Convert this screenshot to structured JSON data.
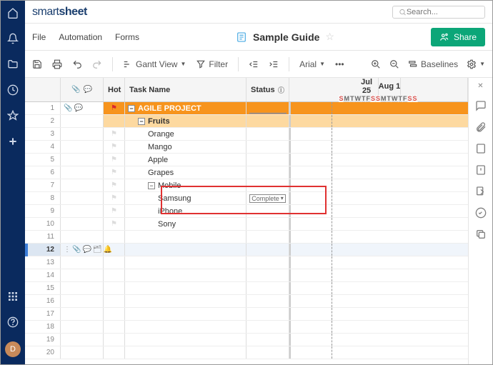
{
  "app": {
    "logo_prefix": "smart",
    "logo_bold": "sheet"
  },
  "search": {
    "placeholder": "Search..."
  },
  "menubar": {
    "items": [
      "File",
      "Automation",
      "Forms"
    ],
    "title": "Sample Guide"
  },
  "share": {
    "label": "Share"
  },
  "toolbar": {
    "view_label": "Gantt View",
    "filter_label": "Filter",
    "font_label": "Arial",
    "baselines_label": "Baselines"
  },
  "columns": {
    "hot": "Hot",
    "task": "Task Name",
    "status": "Status"
  },
  "gantt": {
    "months": [
      "Jul 25",
      "Aug 1"
    ],
    "days": [
      "S",
      "M",
      "T",
      "W",
      "T",
      "F",
      "S",
      "S",
      "M",
      "T",
      "W",
      "T",
      "F",
      "S",
      "S"
    ],
    "weekend_indices": [
      0,
      6,
      7,
      13,
      14
    ],
    "today_pct": 23
  },
  "rows": [
    {
      "n": 1,
      "level": 0,
      "task": "AGILE PROJECT",
      "flag": "red",
      "toggle": "−",
      "attach": true,
      "comment": true
    },
    {
      "n": 2,
      "level": 1,
      "task": "Fruits",
      "toggle": "−"
    },
    {
      "n": 3,
      "level": 2,
      "task": "Orange",
      "flag": "gray"
    },
    {
      "n": 4,
      "level": 2,
      "task": "Mango",
      "flag": "gray"
    },
    {
      "n": 5,
      "level": 2,
      "task": "Apple",
      "flag": "gray"
    },
    {
      "n": 6,
      "level": 2,
      "task": "Grapes",
      "flag": "gray"
    },
    {
      "n": 7,
      "level": 2,
      "task": "Mobile",
      "flag": "gray",
      "toggle": "−"
    },
    {
      "n": 8,
      "level": 3,
      "task": "Samsung",
      "flag": "gray",
      "status": "Complete",
      "status_dd": true
    },
    {
      "n": 9,
      "level": 3,
      "task": "iPhone",
      "flag": "gray"
    },
    {
      "n": 10,
      "level": 3,
      "task": "Sony",
      "flag": "gray"
    },
    {
      "n": 11
    },
    {
      "n": 12,
      "selected": true,
      "row_icons": true
    },
    {
      "n": 13
    },
    {
      "n": 14
    },
    {
      "n": 15
    },
    {
      "n": 16
    },
    {
      "n": 17
    },
    {
      "n": 18
    },
    {
      "n": 19
    },
    {
      "n": 20
    }
  ],
  "avatar_initial": "D"
}
